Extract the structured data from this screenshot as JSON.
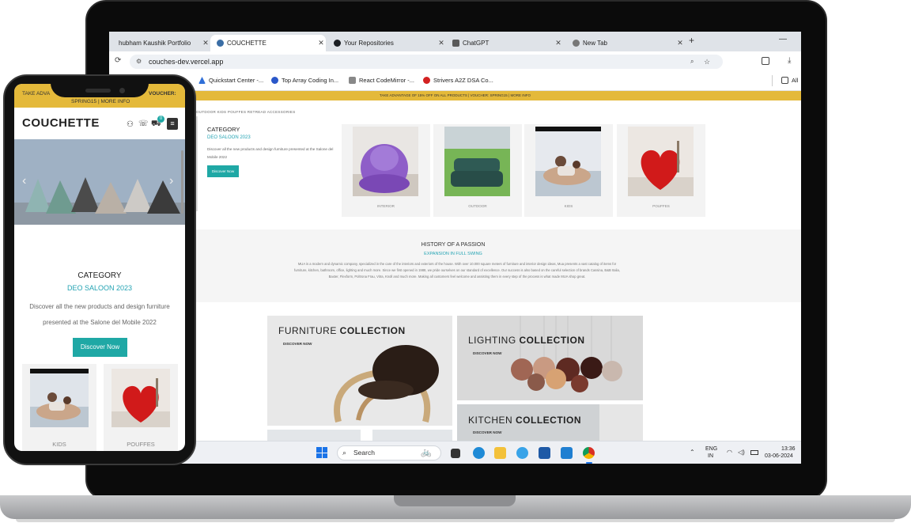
{
  "browser": {
    "tabs": [
      {
        "label": "hubham Kaushik Portfolio",
        "active": false
      },
      {
        "label": "COUCHETTE",
        "active": true
      },
      {
        "label": "Your Repositories",
        "active": false
      },
      {
        "label": "ChatGPT",
        "active": false
      },
      {
        "label": "New Tab",
        "active": false
      }
    ],
    "url": "couches-dev.vercel.app",
    "bookmarks": [
      {
        "label": "Quickstart Center -..."
      },
      {
        "label": "Top Array Coding In..."
      },
      {
        "label": "React CodeMirror -..."
      },
      {
        "label": "Strivers A2Z DSA Co..."
      },
      {
        "label": "All"
      }
    ]
  },
  "site": {
    "promo": "TAKE ADVANTAGE OF 15% OFF ON ALL PRODUCTS | VOUCHER: SPRING15 | MORE INFO",
    "nav": "OUTDOOR KIDS POUFFES RETREAD ACCESSORIES",
    "category": {
      "title": "CATEGORY",
      "subtitle": "DEO SALOON 2023",
      "description": "Discover all the new products and design furniture presented at the Salone del Mobile 2022",
      "button": "Discover Now"
    },
    "cards": [
      {
        "label": "INTERIOR"
      },
      {
        "label": "OUTDOOR"
      },
      {
        "label": "KIDS"
      },
      {
        "label": "POUFFES"
      }
    ],
    "history": {
      "title": "HISTORY OF A PASSION",
      "subtitle": "EXPANSION IN FULL SWING",
      "body": "MUA is a modern and dynamic company, specialized in the care of the interiors and exteriors of the house. With over 10.000 square meters of furniture and interior design ideas, Mua presents a vast catalog of items for furniture, kitchen, bathroom, office, lighting and much more. Since we first opened in 1988, we pride ourselves on our standard of excellence. Our success is also based on the careful selection of brands Cassina, B&B Italia, Baxter, Flexform, Poltrona Frau, Vitra, Knoll and much more. Making all customers feel welcome and assisting them in every step of the process is what made MUA shop great."
    },
    "collections": [
      {
        "prefix": "FURNITURE",
        "word": "COLLECTION",
        "cta": "DISCOVER NOW"
      },
      {
        "prefix": "LIGHTING",
        "word": "COLLECTION",
        "cta": "DISCOVER NOW"
      },
      {
        "prefix": "KITCHEN",
        "word": "COLLECTION",
        "cta": "DISCOVER NOW"
      }
    ]
  },
  "taskbar": {
    "search": "Search",
    "lang": "ENG",
    "region": "IN",
    "time": "13:36",
    "date": "03-06-2024"
  },
  "phone": {
    "promo_line1": "TAKE ADVA",
    "promo_voucher": "VOUCHER:",
    "promo_line2": "SPRING15 | MORE INFO",
    "logo": "COUCHETTE",
    "cart_count": "0",
    "category": "CATEGORY",
    "subtitle": "DEO SALOON 2023",
    "description": "Discover all the new products and design furniture presented at the Salone del Mobile 2022",
    "button": "Discover Now",
    "cards": [
      {
        "label": "KIDS"
      },
      {
        "label": "POUFFES"
      }
    ]
  },
  "colors": {
    "accent": "#1fa8a5",
    "promo": "#e4b93a",
    "link": "#23a3b3"
  }
}
